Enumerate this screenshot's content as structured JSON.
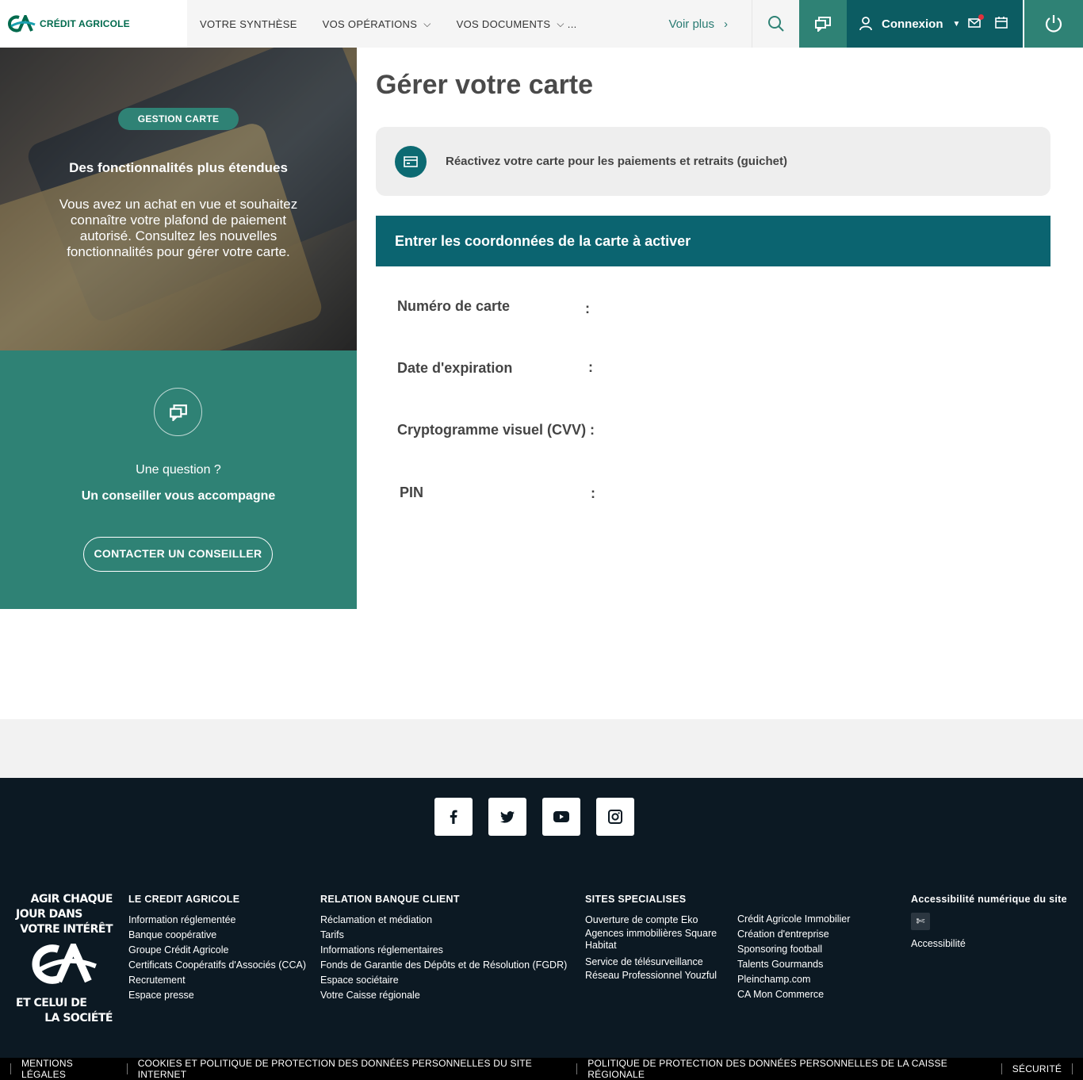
{
  "brand": {
    "name": "CRÉDIT AGRICOLE"
  },
  "nav": {
    "items": [
      {
        "label": "VOTRE SYNTHÈSE",
        "chevron": false
      },
      {
        "label": "VOS OPÉRATIONS",
        "chevron": true
      },
      {
        "label": "VOS DOCUMENTS",
        "chevron": true
      }
    ],
    "ellipsis": "...",
    "more": "Voir plus",
    "connexion": "Connexion"
  },
  "promo": {
    "badge": "GESTION CARTE",
    "title": "Des fonctionnalités plus étendues",
    "text": "Vous avez un achat en vue et souhaitez connaître votre plafond de paiement autorisé. Consultez les nouvelles fonctionnalités pour gérer votre carte."
  },
  "help": {
    "question": "Une question ?",
    "subtitle": "Un conseiller vous accompagne",
    "button": "CONTACTER UN CONSEILLER"
  },
  "main": {
    "title": "Gérer votre carte",
    "reactivate": "Réactivez votre carte pour les paiements et retraits (guichet)",
    "form_header": "Entrer les coordonnées de la carte à activer",
    "fields": {
      "card_number": "Numéro de carte",
      "expiry": "Date d'expiration",
      "cvv": "Cryptogramme visuel (CVV)",
      "pin": "PIN",
      "colon": ":"
    }
  },
  "footer": {
    "slogan": [
      "AGIR CHAQUE",
      "JOUR DANS",
      "VOTRE INTÉRÊT",
      "ET CELUI DE",
      "LA SOCIÉTÉ"
    ],
    "col1": {
      "title": "LE CREDIT AGRICOLE",
      "links": [
        "Information réglementée",
        "Banque coopérative",
        "Groupe Crédit Agricole",
        "Certificats Coopératifs d'Associés (CCA)",
        "Recrutement",
        "Espace presse"
      ]
    },
    "col2": {
      "title": "RELATION BANQUE CLIENT",
      "links": [
        "Réclamation et médiation",
        "Tarifs",
        "Informations réglementaires",
        "Fonds de Garantie des Dépôts et de Résolution (FGDR)",
        "Espace sociétaire",
        "Votre Caisse régionale"
      ]
    },
    "col3": {
      "title": "SITES SPECIALISES",
      "links": [
        "Ouverture de compte Eko",
        "Agences immobilières Square Habitat",
        "Service de télésurveillance",
        "Réseau Professionnel Youzful"
      ]
    },
    "col4": {
      "links": [
        "Crédit Agricole Immobilier",
        "Création d'entreprise",
        "Sponsoring football",
        "Talents Gourmands",
        "Pleinchamp.com",
        "CA Mon Commerce"
      ]
    },
    "col5": {
      "title": "Accessibilité numérique du site",
      "link": "Accessibilité"
    },
    "legal": [
      "MENTIONS LÉGALES",
      "COOKIES ET POLITIQUE DE PROTECTION DES DONNÉES PERSONNELLES DU SITE INTERNET",
      "POLITIQUE DE PROTECTION DES DONNÉES PERSONNELLES DE LA CAISSE RÉGIONALE",
      "SÉCURITÉ"
    ]
  },
  "colors": {
    "teal": "#2f8275",
    "dark_teal": "#0c5c62",
    "band": "#0b6470",
    "footer": "#0c1923",
    "notification": "#e0313d"
  }
}
